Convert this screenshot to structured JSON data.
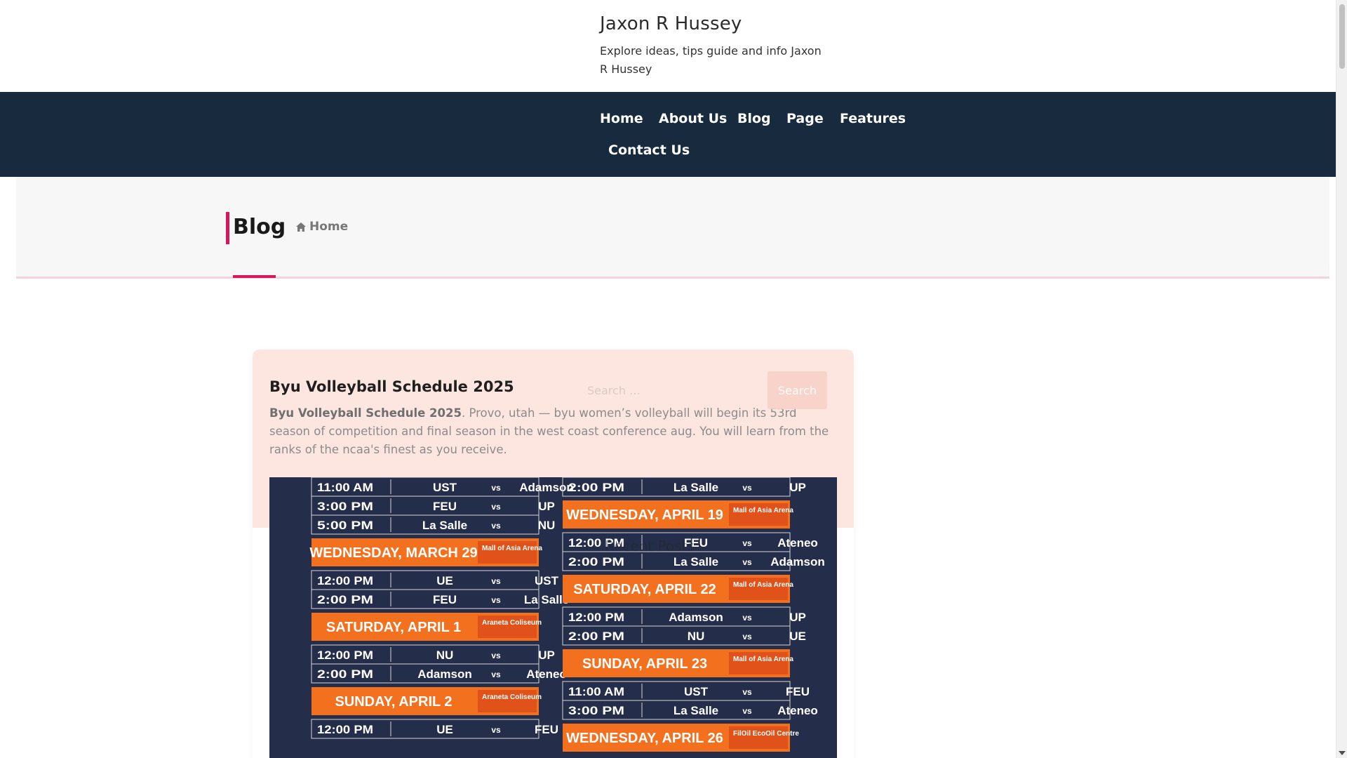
{
  "header": {
    "site_title": "Jaxon R Hussey",
    "tagline": "Explore ideas, tips guide and info Jaxon R Hussey"
  },
  "nav": {
    "items": [
      "Home",
      "About Us",
      "Blog",
      "Page",
      "Features",
      "Contact Us"
    ]
  },
  "banner": {
    "title": "Blog",
    "breadcrumb_home": "Home"
  },
  "post": {
    "title": "Byu Volleyball Schedule 2025",
    "excerpt_bold": "Byu Volleyball Schedule 2025",
    "excerpt_rest": ". Provo, utah — byu women’s volleyball will begin its 53rd season of competition and final season in the west coast conference aug. You will learn from the ranks of the ncaa's finest as you receive."
  },
  "search": {
    "placeholder": "Search …",
    "button_label": "Search"
  },
  "faded_sidebar_text": "Recent Posts",
  "schedule": {
    "left_column": [
      {
        "type": "game",
        "time": "11:00 AM",
        "home": "UST",
        "away": "Adamson"
      },
      {
        "type": "game",
        "time": "3:00 PM",
        "home": "FEU",
        "away": "UP"
      },
      {
        "type": "game",
        "time": "5:00 PM",
        "home": "La Salle",
        "away": "NU"
      },
      {
        "type": "day",
        "label": "WEDNESDAY, MARCH 29",
        "venue": "Mall of Asia Arena"
      },
      {
        "type": "game",
        "time": "12:00 PM",
        "home": "UE",
        "away": "UST"
      },
      {
        "type": "game",
        "time": "2:00 PM",
        "home": "FEU",
        "away": "La Salle"
      },
      {
        "type": "day",
        "label": "SATURDAY, APRIL 1",
        "venue": "Araneta Coliseum"
      },
      {
        "type": "game",
        "time": "12:00 PM",
        "home": "NU",
        "away": "UP"
      },
      {
        "type": "game",
        "time": "2:00 PM",
        "home": "Adamson",
        "away": "Ateneo"
      },
      {
        "type": "day",
        "label": "SUNDAY, APRIL 2",
        "venue": "Araneta Coliseum"
      },
      {
        "type": "game",
        "time": "12:00 PM",
        "home": "UE",
        "away": "FEU"
      }
    ],
    "right_column": [
      {
        "type": "game",
        "time": "2:00 PM",
        "home": "La Salle",
        "away": "UP"
      },
      {
        "type": "day",
        "label": "WEDNESDAY, APRIL 19",
        "venue": "Mall of Asia Arena"
      },
      {
        "type": "game",
        "time": "12:00 PM",
        "home": "FEU",
        "away": "Ateneo"
      },
      {
        "type": "game",
        "time": "2:00 PM",
        "home": "La Salle",
        "away": "Adamson"
      },
      {
        "type": "day",
        "label": "SATURDAY, APRIL 22",
        "venue": "Mall of Asia Arena"
      },
      {
        "type": "game",
        "time": "12:00 PM",
        "home": "Adamson",
        "away": "UP"
      },
      {
        "type": "game",
        "time": "2:00 PM",
        "home": "NU",
        "away": "UE"
      },
      {
        "type": "day",
        "label": "SUNDAY, APRIL 23",
        "venue": "Mall of Asia Arena"
      },
      {
        "type": "game",
        "time": "11:00 AM",
        "home": "UST",
        "away": "FEU"
      },
      {
        "type": "game",
        "time": "3:00 PM",
        "home": "La Salle",
        "away": "Ateneo"
      },
      {
        "type": "day",
        "label": "WEDNESDAY, APRIL 26",
        "venue": "FilOil EcoOil Centre"
      }
    ],
    "vs_label": "vs"
  },
  "colors": {
    "nav_bg": "#172a3e",
    "accent": "#d6175c",
    "card_top": "#fde6df",
    "schedule_orange": "#f2701e",
    "schedule_bg": "#20263a"
  }
}
